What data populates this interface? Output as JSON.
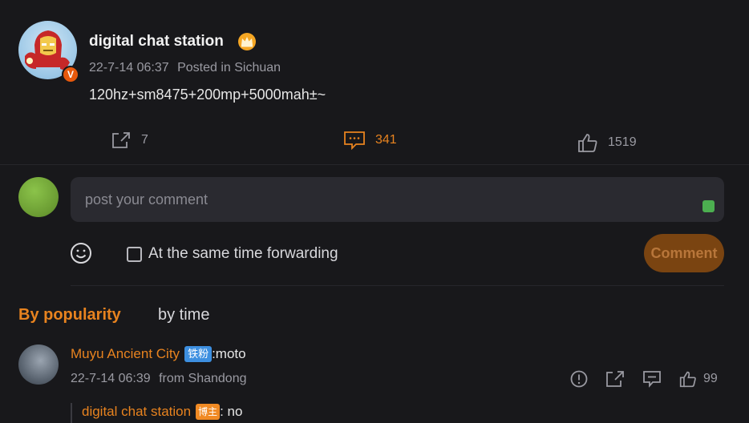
{
  "post": {
    "author": "digital chat station",
    "verified_badge": "V",
    "date": "22-7-14 06:37",
    "location": "Posted in Sichuan",
    "text": "120hz+sm8475+200mp+5000mah±~",
    "forward_count": "7",
    "comment_count": "341",
    "like_count": "1519"
  },
  "composer": {
    "placeholder": "post your comment",
    "forward_label": "At the same time forwarding",
    "submit_label": "Comment"
  },
  "sort": {
    "popularity": "By popularity",
    "time": "by time"
  },
  "comments": [
    {
      "user": "Muyu Ancient City",
      "badge": "铁粉",
      "text": ":moto",
      "date": "22-7-14 06:39",
      "location": "from Shandong",
      "like_count": "99",
      "reply": {
        "user": "digital chat station",
        "badge": "博主",
        "text": ": no"
      }
    }
  ],
  "colors": {
    "background": "#18181b",
    "accent": "#e8831f",
    "muted": "#9a9aa2"
  },
  "icons": [
    "crown-icon",
    "share-icon",
    "comment-icon",
    "thumbs-up-icon",
    "emoji-icon",
    "report-icon",
    "forward-icon",
    "reply-icon"
  ]
}
